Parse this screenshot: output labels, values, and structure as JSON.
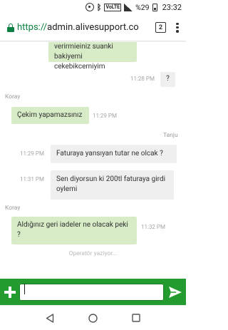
{
  "status_bar": {
    "volte": "VoLTE",
    "network": "4G",
    "battery_text": "%29",
    "battery_level": 0.29,
    "clock": "23:32"
  },
  "browser": {
    "url_scheme": "https://",
    "url_host": "admin.alivesupport.co",
    "tab_count": "2"
  },
  "chat": {
    "messages": [
      {
        "side": "in",
        "text": "verirmieiniz suanki bakiyemi cekebikcemiyim",
        "time": ""
      },
      {
        "side": "out",
        "text": "?",
        "time": "11:28 PM"
      },
      {
        "side": "in",
        "sender": "Koray",
        "text": "Çekim yapamazsınız",
        "time": "11:29 PM"
      },
      {
        "side": "out",
        "sender": "Tanju",
        "text": "Faturaya yansıyan tutar ne olcak ?",
        "time": "11:29 PM"
      },
      {
        "side": "out",
        "text": "Sen diyorsun ki 200tl faturaya girdi oylemi",
        "time": "11:31 PM"
      },
      {
        "side": "in",
        "sender": "Koray",
        "text": "Aldığınız geri iadeler ne olacak peki ?",
        "time": "11:32 PM"
      }
    ],
    "typing_indicator": "Operatör yaziyor..."
  },
  "composer": {
    "value": "",
    "placeholder": "",
    "accent_color": "#249b2e"
  },
  "colors": {
    "incoming_bubble": "#d7ecc6",
    "outgoing_bubble": "#efefef",
    "secure_green": "#0b8043"
  }
}
